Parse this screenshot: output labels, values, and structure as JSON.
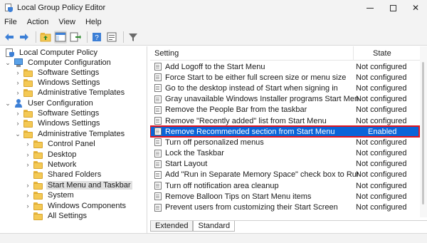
{
  "window": {
    "title": "Local Group Policy Editor"
  },
  "menubar": [
    {
      "label": "File"
    },
    {
      "label": "Action"
    },
    {
      "label": "View"
    },
    {
      "label": "Help"
    }
  ],
  "tree": [
    {
      "label": "Local Computer Policy",
      "icon": "policy-icon",
      "level": 0,
      "expander": ""
    },
    {
      "label": "Computer Configuration",
      "icon": "computer-icon",
      "level": 0,
      "expander": "collapse"
    },
    {
      "label": "Software Settings",
      "icon": "folder-icon",
      "level": 1,
      "expander": "expand"
    },
    {
      "label": "Windows Settings",
      "icon": "folder-icon",
      "level": 1,
      "expander": "expand"
    },
    {
      "label": "Administrative Templates",
      "icon": "folder-icon",
      "level": 1,
      "expander": "expand"
    },
    {
      "label": "User Configuration",
      "icon": "user-icon",
      "level": 0,
      "expander": "collapse"
    },
    {
      "label": "Software Settings",
      "icon": "folder-icon",
      "level": 1,
      "expander": "expand"
    },
    {
      "label": "Windows Settings",
      "icon": "folder-icon",
      "level": 1,
      "expander": "expand"
    },
    {
      "label": "Administrative Templates",
      "icon": "folder-icon",
      "level": 1,
      "expander": "collapse"
    },
    {
      "label": "Control Panel",
      "icon": "folder-icon",
      "level": 2,
      "expander": "expand"
    },
    {
      "label": "Desktop",
      "icon": "folder-icon",
      "level": 2,
      "expander": "expand"
    },
    {
      "label": "Network",
      "icon": "folder-icon",
      "level": 2,
      "expander": "expand"
    },
    {
      "label": "Shared Folders",
      "icon": "folder-icon",
      "level": 2,
      "expander": ""
    },
    {
      "label": "Start Menu and Taskbar",
      "icon": "folder-icon",
      "level": 2,
      "expander": "expand",
      "selected": true
    },
    {
      "label": "System",
      "icon": "folder-icon",
      "level": 2,
      "expander": "expand"
    },
    {
      "label": "Windows Components",
      "icon": "folder-icon",
      "level": 2,
      "expander": "expand"
    },
    {
      "label": "All Settings",
      "icon": "folder-icon",
      "level": 2,
      "expander": ""
    }
  ],
  "list": {
    "columns": {
      "setting": "Setting",
      "state": "State"
    },
    "rows": [
      {
        "name": "Add Logoff to the Start Menu",
        "state": "Not configured"
      },
      {
        "name": "Force Start to be either full screen size or menu size",
        "state": "Not configured"
      },
      {
        "name": "Go to the desktop instead of Start when signing in",
        "state": "Not configured"
      },
      {
        "name": "Gray unavailable Windows Installer programs Start Menu sh...",
        "state": "Not configured"
      },
      {
        "name": "Remove the People Bar from the taskbar",
        "state": "Not configured"
      },
      {
        "name": "Remove \"Recently added\" list from Start Menu",
        "state": "Not configured"
      },
      {
        "name": "Remove Recommended section from Start Menu",
        "state": "Enabled",
        "selected": true
      },
      {
        "name": "Turn off personalized menus",
        "state": "Not configured"
      },
      {
        "name": "Lock the Taskbar",
        "state": "Not configured"
      },
      {
        "name": "Start Layout",
        "state": "Not configured"
      },
      {
        "name": "Add \"Run in Separate Memory Space\" check box to Run dial...",
        "state": "Not configured"
      },
      {
        "name": "Turn off notification area cleanup",
        "state": "Not configured"
      },
      {
        "name": "Remove Balloon Tips on Start Menu items",
        "state": "Not configured"
      },
      {
        "name": "Prevent users from customizing their Start Screen",
        "state": "Not configured"
      }
    ]
  },
  "tabs": [
    {
      "label": "Extended",
      "active": false
    },
    {
      "label": "Standard",
      "active": true
    }
  ],
  "colors": {
    "selection": "#0a64d8",
    "highlight_border": "#e0141e"
  }
}
